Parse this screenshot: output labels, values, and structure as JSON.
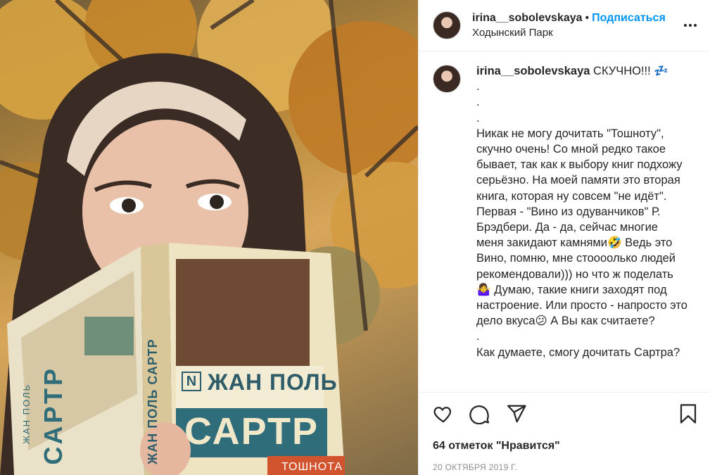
{
  "post": {
    "username": "irina__sobolevskaya",
    "separator": "•",
    "follow_label": "Подписаться",
    "location": "Ходынский Парк",
    "more_icon": "more-horizontal-icon"
  },
  "photo": {
    "book_author_spine": "ЖАН ПОЛЬ САРТР",
    "book_author_cover_line1": "ЖАН ПОЛЬ",
    "book_author_cover_line2": "САРТР",
    "book_back_author": "САРТР",
    "book_back_author_small": "ЖАН ПОЛЬ",
    "book_title": "ТОШНОТА",
    "series_mark": "N"
  },
  "caption": {
    "username": "irina__sobolevskaya",
    "text": " СКУЧНО!!! 💤\n.\n.\n.\nНикак не могу дочитать \"Тошноту\", скучно очень! Со мной редко такое бывает, так как к выбору книг подхожу серьёзно. На моей памяти это вторая книга, которая ну совсем \"не идёт\". Первая - \"Вино из одуванчиков\" Р. Брэдбери. Да - да, сейчас многие меня закидают камнями🤣 Ведь это Вино, помню, мне стоооолько людей рекомендовали))) но что ж поделать 🤷‍♀️ Думаю, такие книги заходят под настроение. Или просто - напросто это дело вкуса😕 А Вы как считаете?\n.\nКак думаете, смогу дочитать Сартра?"
  },
  "actions": {
    "like_icon": "heart-icon",
    "comment_icon": "comment-icon",
    "share_icon": "share-icon",
    "save_icon": "bookmark-icon",
    "likes_text": "64 отметок \"Нравится\"",
    "date_text": "20 ОКТЯБРЯ 2019 Г."
  },
  "colors": {
    "accent": "#0095f6",
    "text": "#262626",
    "muted": "#8e8e8e",
    "border": "#efefef"
  }
}
